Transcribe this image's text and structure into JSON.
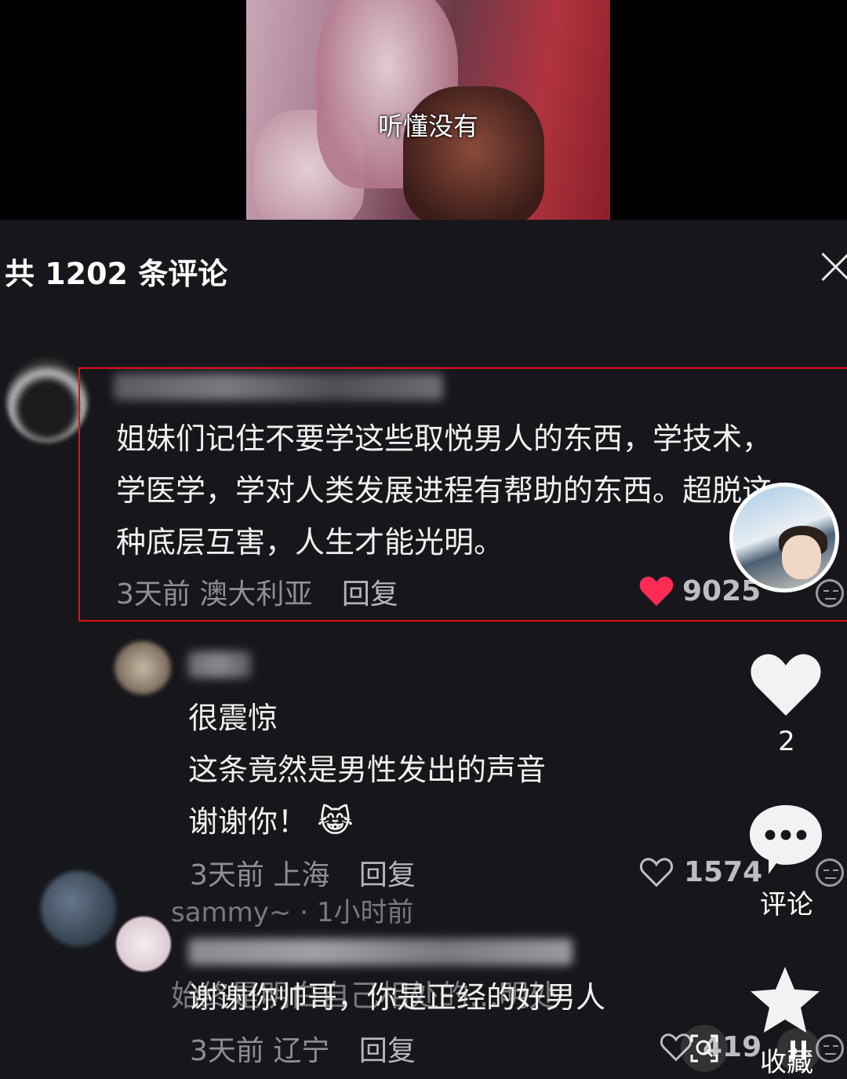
{
  "video": {
    "subtitle": "听懂没有"
  },
  "comments_panel": {
    "title": "共 1202 条评论",
    "close_icon": "close-icon",
    "comments": [
      {
        "text_lines": [
          "姐妹们记住不要学这些取悦男人的东西，学技术，",
          "学医学，学对人类发展进程有帮助的东西。超脱这",
          "种底层互害，人生才能光明。"
        ],
        "time": "3天前",
        "location": "澳大利亚",
        "reply_label": "回复",
        "likes": "9025",
        "liked": true
      },
      {
        "text_lines": [
          "很震惊",
          "这条竟然是男性发出的声音",
          "谢谢你！"
        ],
        "emoji": "😹",
        "time": "3天前",
        "location": "上海",
        "reply_label": "回复",
        "likes": "1574",
        "liked": false
      },
      {
        "text_lines": [
          "谢谢你帅哥，你是正经的好男人"
        ],
        "time": "3天前",
        "location": "辽宁",
        "reply_label": "回复",
        "likes": "419",
        "liked": false
      }
    ],
    "overlay_ghost": {
      "name": "sammy~ · 1小时前",
      "line": "始终是明白自己相处的…明处"
    }
  },
  "side_actions": {
    "like_count": "2",
    "comment_label": "评论",
    "favorite_label": "收藏"
  },
  "colors": {
    "accent_red": "#fe2c55",
    "highlight_border": "#e0101e",
    "background": "#17171b"
  }
}
